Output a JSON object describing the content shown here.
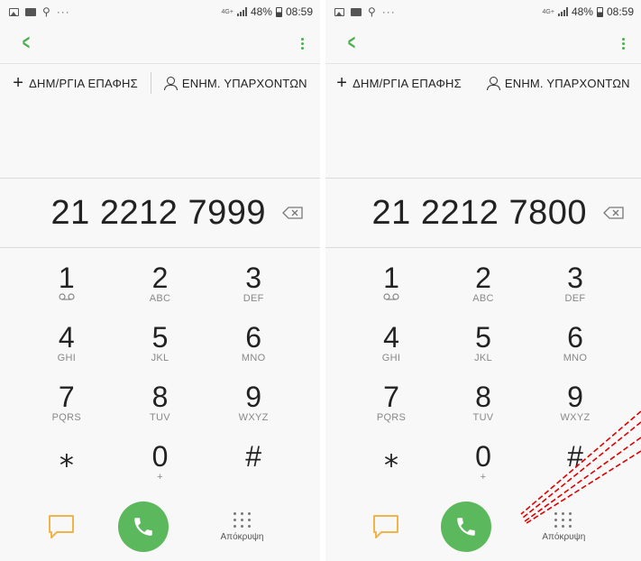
{
  "status_bar": {
    "network": "4G+",
    "battery": "48%",
    "time": "08:59",
    "dots": "···"
  },
  "actions": {
    "create_contact": "ΔΗΜ/ΡΓΙΑ ΕΠΑΦΗΣ",
    "update_existing": "ΕΝΗΜ. ΥΠΑΡΧΟΝΤΩΝ"
  },
  "screens": [
    {
      "number": "21 2212 7999"
    },
    {
      "number": "21 2212 7800"
    }
  ],
  "keypad": [
    {
      "digit": "1",
      "sub": ""
    },
    {
      "digit": "2",
      "sub": "ABC"
    },
    {
      "digit": "3",
      "sub": "DEF"
    },
    {
      "digit": "4",
      "sub": "GHI"
    },
    {
      "digit": "5",
      "sub": "JKL"
    },
    {
      "digit": "6",
      "sub": "MNO"
    },
    {
      "digit": "7",
      "sub": "PQRS"
    },
    {
      "digit": "8",
      "sub": "TUV"
    },
    {
      "digit": "9",
      "sub": "WXYZ"
    },
    {
      "digit": "⁎",
      "sub": ""
    },
    {
      "digit": "0",
      "sub": "+"
    },
    {
      "digit": "#",
      "sub": ""
    }
  ],
  "bottom": {
    "hide_label": "Απόκρυψη"
  },
  "colors": {
    "accent": "#4caf50",
    "call": "#5cb85c",
    "message": "#f0b54a",
    "annotation": "#e00000"
  },
  "icons": [
    "back-icon",
    "more-icon",
    "plus-icon",
    "person-icon",
    "backspace-icon",
    "voicemail-icon",
    "message-icon",
    "phone-icon",
    "keypad-icon"
  ]
}
